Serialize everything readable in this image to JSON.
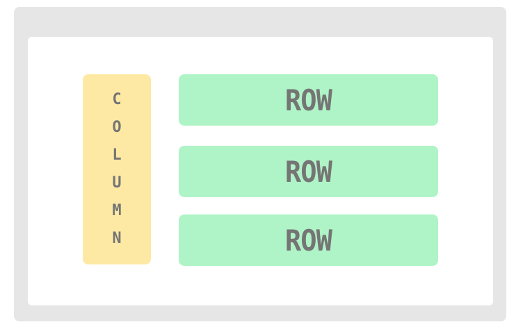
{
  "column": {
    "letters": [
      "C",
      "O",
      "L",
      "U",
      "M",
      "N"
    ]
  },
  "rows": [
    {
      "label": "ROW"
    },
    {
      "label": "ROW"
    },
    {
      "label": "ROW"
    }
  ],
  "colors": {
    "frame": "#e6e6e6",
    "canvas": "#ffffff",
    "column_fill": "#fee9a4",
    "row_fill": "#aff4c6",
    "text": "#757575"
  }
}
